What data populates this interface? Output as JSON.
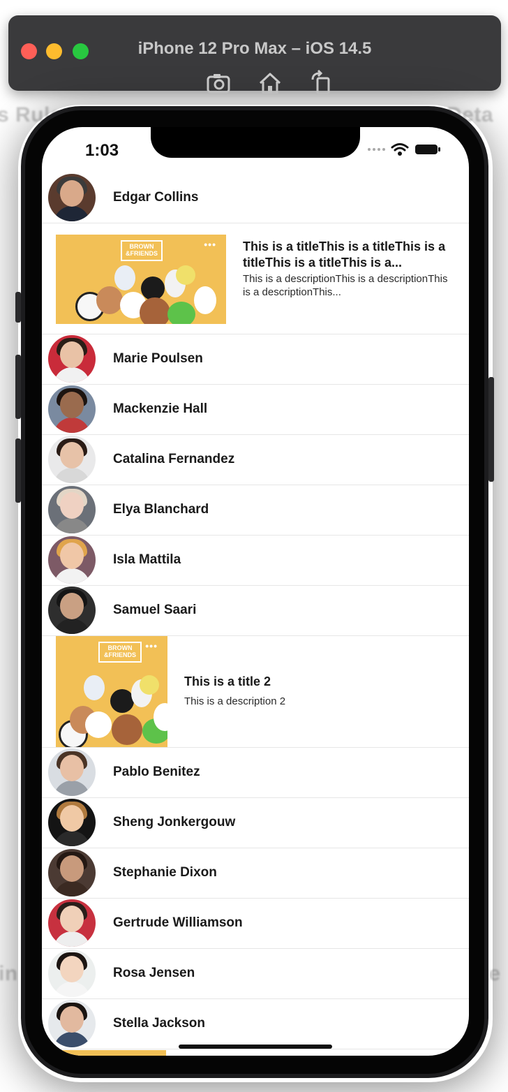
{
  "background": {
    "left_text_top": "s Rule",
    "right_text_top": "Deta",
    "left_text_bottom": "in",
    "right_text_bottom": "te"
  },
  "simulator": {
    "title": "iPhone 12 Pro Max – iOS 14.5",
    "traffic_colors": [
      "#ff5f57",
      "#febc2e",
      "#28c840"
    ],
    "tools": [
      "screenshot-icon",
      "home-icon",
      "rotate-icon"
    ]
  },
  "status_bar": {
    "time": "1:03"
  },
  "list": {
    "rows": [
      {
        "type": "contact",
        "name": "Edgar Collins",
        "skin": "#d9a98a",
        "hair": "#3b3b3b",
        "shirt": "#1e2636",
        "bg": "#5a3b2e"
      },
      {
        "type": "card",
        "title": "This is a titleThis is a titleThis is a titleThis is a titleThis is a...",
        "description": "This is a descriptionThis is a descriptionThis is a descriptionThis...",
        "brand": "BROWN & FRIENDS"
      },
      {
        "type": "contact",
        "name": "Marie Poulsen",
        "skin": "#e9c2a6",
        "hair": "#2a1e17",
        "shirt": "#f1f1f1",
        "bg": "#c92b3a"
      },
      {
        "type": "contact",
        "name": "Mackenzie Hall",
        "skin": "#9a6b4e",
        "hair": "#1d1410",
        "shirt": "#c03a3a",
        "bg": "#7a8aa0"
      },
      {
        "type": "contact",
        "name": "Catalina Fernandez",
        "skin": "#e7c2a8",
        "hair": "#2a1c16",
        "shirt": "#d8d8d8",
        "bg": "#e9e9ea"
      },
      {
        "type": "contact",
        "name": "Elya Blanchard",
        "skin": "#efd1c2",
        "hair": "#e3d6c6",
        "shirt": "#888",
        "bg": "#6b7078"
      },
      {
        "type": "contact",
        "name": "Isla Mattila",
        "skin": "#f0c7a7",
        "hair": "#e0a44c",
        "shirt": "#f2f2f2",
        "bg": "#7d5a66"
      },
      {
        "type": "contact",
        "name": "Samuel Saari",
        "skin": "#c9a083",
        "hair": "#151515",
        "shirt": "#222",
        "bg": "#2e2e2e"
      },
      {
        "type": "card",
        "title": "This is a title 2",
        "description": "This is a description 2",
        "brand": "BROWN & FRIENDS"
      },
      {
        "type": "contact",
        "name": "Pablo Benitez",
        "skin": "#e8c0a5",
        "hair": "#4a3426",
        "shirt": "#9aa0a8",
        "bg": "#d9dde2"
      },
      {
        "type": "contact",
        "name": "Sheng Jonkergouw",
        "skin": "#f0c9a5",
        "hair": "#b07a3e",
        "shirt": "#2a2a2a",
        "bg": "#141414"
      },
      {
        "type": "contact",
        "name": "Stephanie Dixon",
        "skin": "#c89a7c",
        "hair": "#241813",
        "shirt": "#3b2a22",
        "bg": "#4b3a33"
      },
      {
        "type": "contact",
        "name": "Gertrude Williamson",
        "skin": "#f0d0b8",
        "hair": "#2a1f1a",
        "shirt": "#eeeeee",
        "bg": "#c7313f"
      },
      {
        "type": "contact",
        "name": "Rosa Jensen",
        "skin": "#f3d5bf",
        "hair": "#1c1512",
        "shirt": "#f5f5f5",
        "bg": "#ecefee"
      },
      {
        "type": "contact",
        "name": "Stella Jackson",
        "skin": "#e2b99f",
        "hair": "#1a1411",
        "shirt": "#3b4e6b",
        "bg": "#e6e9ec"
      }
    ]
  }
}
